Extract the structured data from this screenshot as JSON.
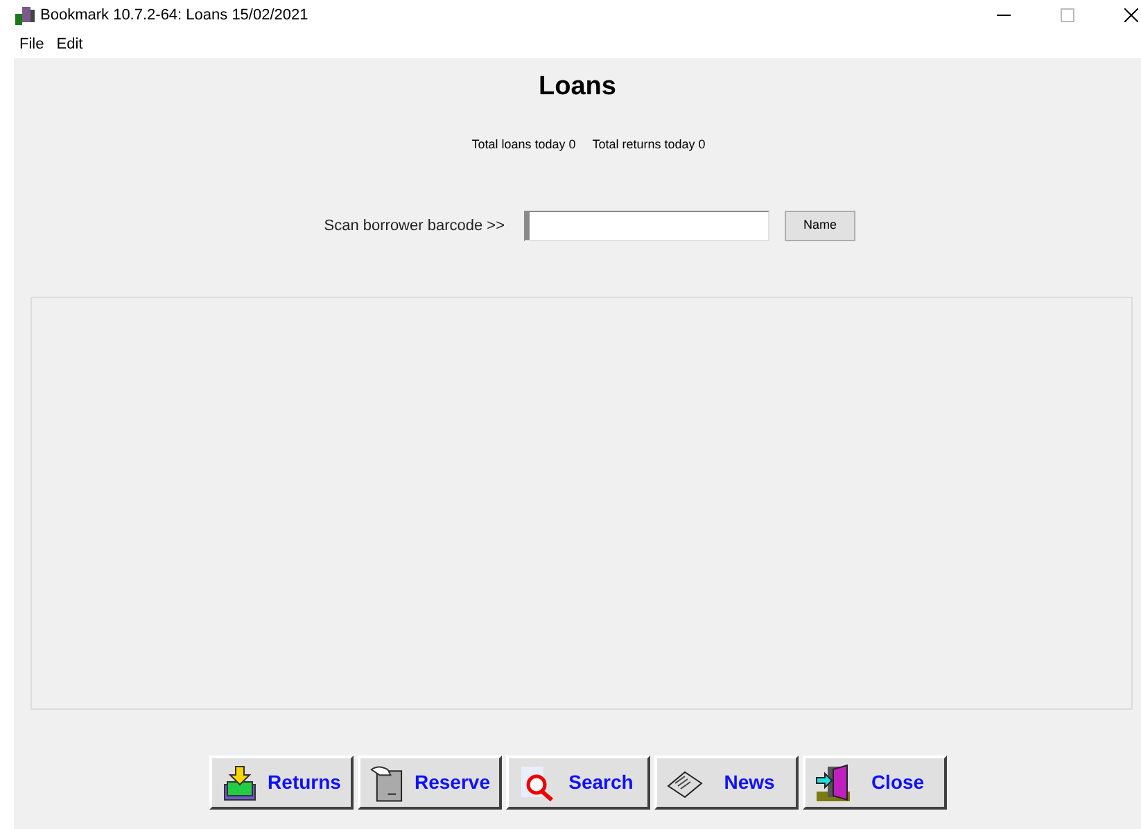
{
  "window": {
    "title": "Bookmark 10.7.2-64: Loans 15/02/2021"
  },
  "menu": [
    "File",
    "Edit"
  ],
  "heading": "Loans",
  "totals": [
    "Total loans today 0",
    "Total returns today 0"
  ],
  "scan": {
    "label": "Scan borrower barcode >>",
    "button": "Name"
  },
  "buttons": [
    "Returns",
    "Reserve",
    "Search",
    "News",
    "Close"
  ]
}
